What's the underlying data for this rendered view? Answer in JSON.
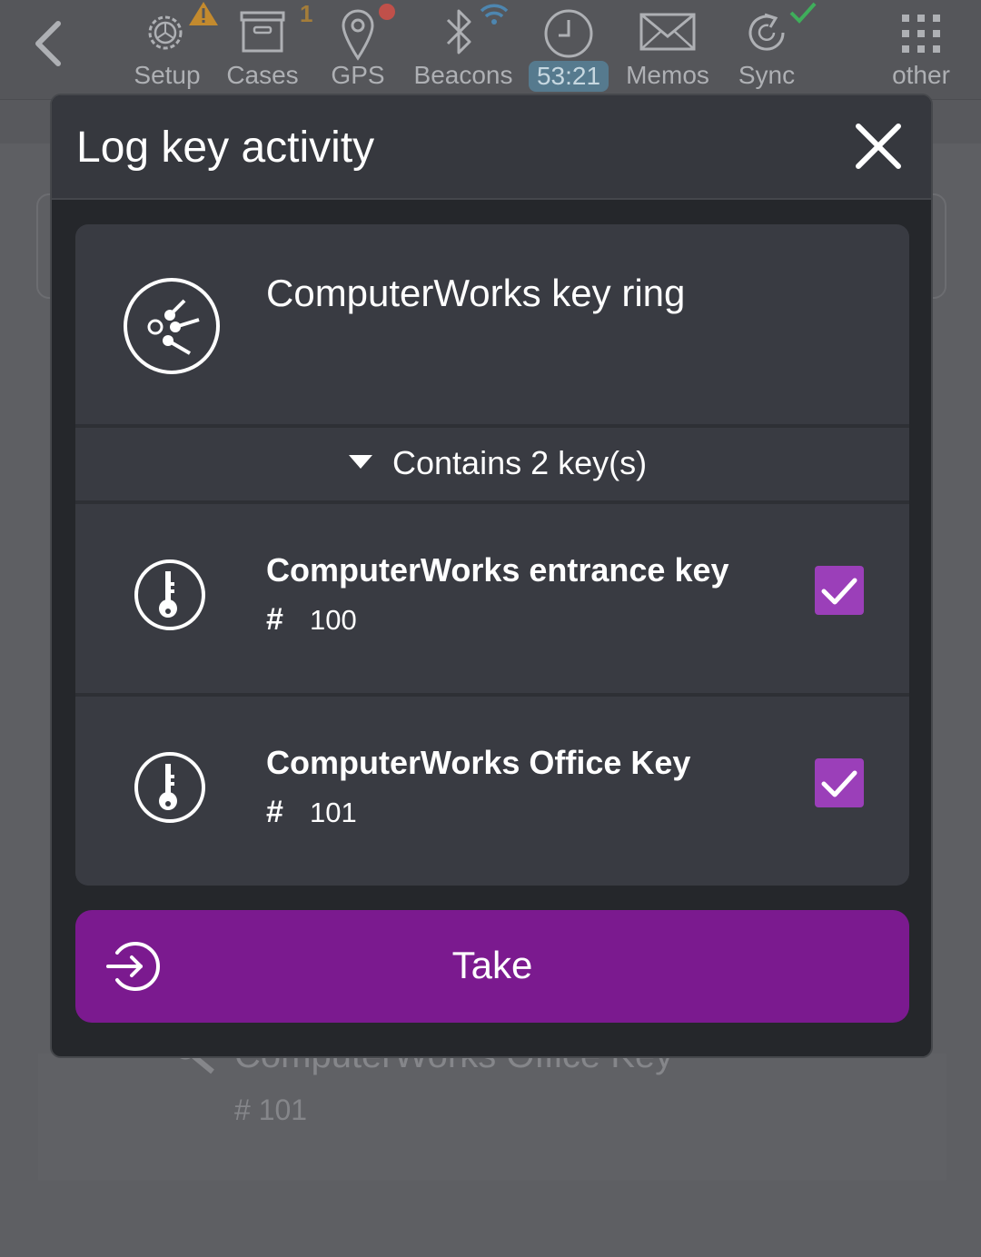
{
  "nav": {
    "items": [
      {
        "label": "Setup",
        "icon": "gear-icon"
      },
      {
        "label": "Cases",
        "icon": "archive-box-icon",
        "badge": "1"
      },
      {
        "label": "GPS",
        "icon": "map-pin-icon"
      },
      {
        "label": "Beacons",
        "icon": "bluetooth-icon"
      },
      {
        "label": "53:21",
        "icon": "clock-icon"
      },
      {
        "label": "Memos",
        "icon": "envelope-icon"
      },
      {
        "label": "Sync",
        "icon": "sync-icon"
      },
      {
        "label": "other",
        "icon": "grid-dots-icon"
      }
    ],
    "colors": {
      "warning": "#c38a2e",
      "alert": "#c0504a",
      "ok": "#3fae5b",
      "wifi": "#4d86b0"
    }
  },
  "modal": {
    "title": "Log key activity",
    "ring": {
      "title": "ComputerWorks key ring",
      "contains": "Contains 2 key(s)",
      "keys": [
        {
          "title": "ComputerWorks entrance key",
          "hash": "#",
          "number": "100",
          "checked": true
        },
        {
          "title": "ComputerWorks Office Key",
          "hash": "#",
          "number": "101",
          "checked": true
        }
      ]
    },
    "action": {
      "label": "Take"
    }
  },
  "background": {
    "key_title": "ComputerWorks Office Key",
    "key_number": "# 101"
  },
  "colors": {
    "accent": "#7b1a8f",
    "checkbox": "#9b3fb9",
    "modal_bg": "#25272b",
    "card_bg": "#393b42"
  }
}
